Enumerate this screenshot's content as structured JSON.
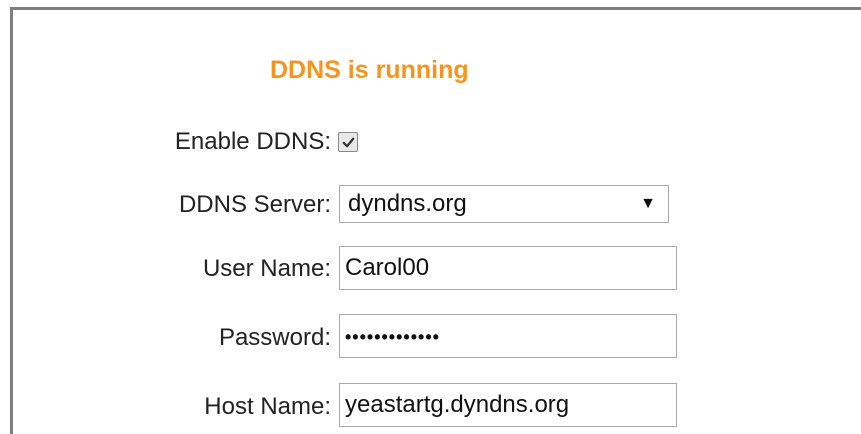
{
  "status": {
    "text": "DDNS is running",
    "color": "#f7941d"
  },
  "form": {
    "enable": {
      "label": "Enable DDNS:",
      "checked": true
    },
    "server": {
      "label": "DDNS Server:",
      "value": "dyndns.org"
    },
    "username": {
      "label": "User Name:",
      "value": "Carol00"
    },
    "password": {
      "label": "Password:",
      "masked_value": "•••••••••••••"
    },
    "hostname": {
      "label": "Host Name:",
      "value": "yeastartg.dyndns.org"
    }
  },
  "icons": {
    "checkbox": "checkmark-icon",
    "dropdown": "dropdown-arrow-icon"
  }
}
